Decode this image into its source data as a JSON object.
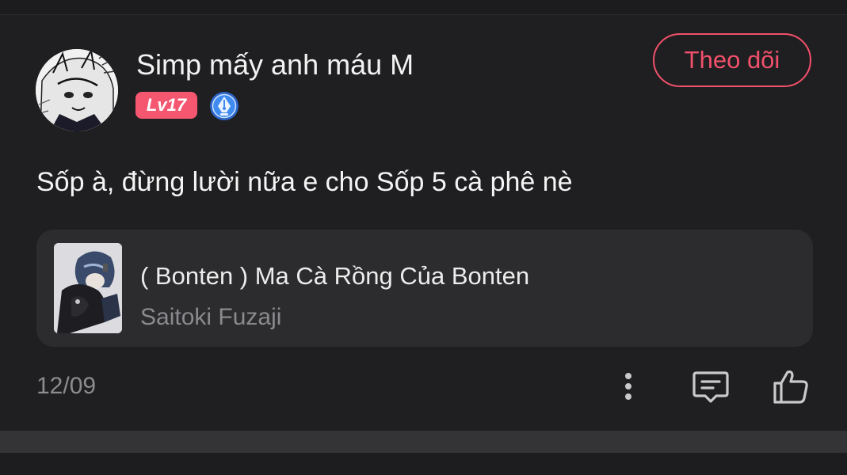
{
  "post": {
    "username": "Simp mấy anh máu M",
    "level": "Lv17",
    "follow_label": "Theo dõi",
    "content": "Sốp à, đừng lười nữa e cho Sốp 5 cà phê nè",
    "date": "12/09"
  },
  "story": {
    "title": "( Bonten ) Ma Cà Rồng Của Bonten",
    "author": "Saitoki Fuzaji"
  },
  "icons": {
    "more": "more-vertical-icon",
    "comment": "comment-icon",
    "like": "thumbs-up-icon",
    "author_badge": "pen-nib-badge-icon"
  },
  "colors": {
    "accent": "#f2506b",
    "level_badge": "#f4576f",
    "badge_blue": "#3a7ee6",
    "background": "#1f1f21",
    "card": "#2c2c2e"
  }
}
